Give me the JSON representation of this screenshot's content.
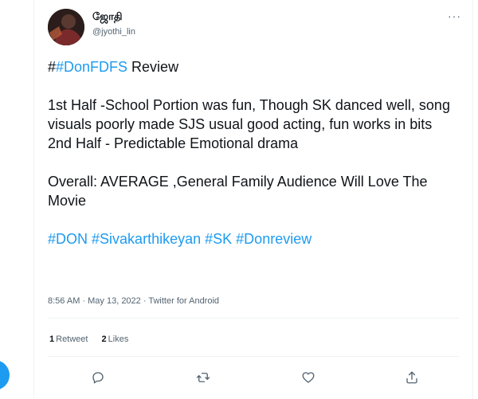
{
  "user": {
    "name": "ஜோதி",
    "handle": "@jyothi_lin"
  },
  "more_label": "···",
  "tweet": {
    "hash_prefix": "#",
    "hashtag_title": "#DonFDFS",
    "title_rest": " Review",
    "line1": "1st Half -School Portion was fun, Though SK danced well, song visuals poorly made SJS usual good acting, fun works in bits",
    "line2": "2nd Half - Predictable Emotional drama",
    "overall": "Overall: AVERAGE ,General Family Audience Will Love The Movie",
    "hashtags": [
      "#DON",
      "#Sivakarthikeyan",
      "#SK",
      "#Donreview"
    ]
  },
  "meta": {
    "time": "8:56 AM · May 13, 2022 · ",
    "app": "Twitter for Android"
  },
  "stats": {
    "retweets_count": "1",
    "retweets_label": "Retweet",
    "likes_count": "2",
    "likes_label": "Likes"
  },
  "icons": {
    "reply": "reply-icon",
    "retweet": "retweet-icon",
    "like": "heart-icon",
    "share": "share-icon"
  },
  "colors": {
    "accent": "#1d9bf0",
    "text": "#0f1419",
    "secondary": "#536471"
  }
}
